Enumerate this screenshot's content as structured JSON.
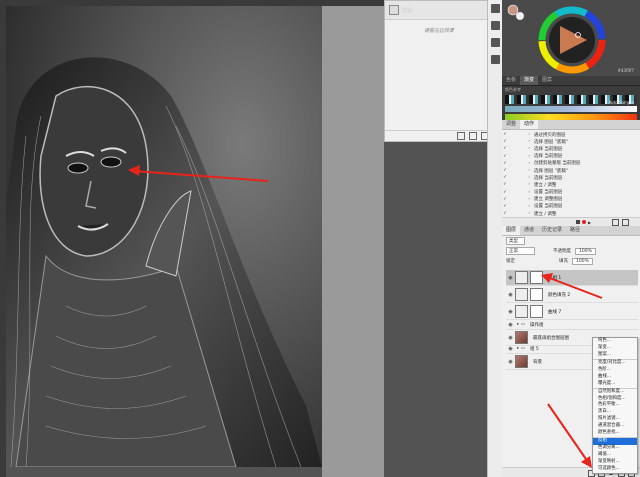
{
  "history_panel": {
    "title": "历史记录",
    "tab_label": "剪贴",
    "empty_message": "请看左边效果"
  },
  "color_panel": {
    "tabs": [
      "色板",
      "渐变",
      "图案",
      "颜色"
    ],
    "swatch_label": "颜色参考",
    "hex_value": "#43f0f7",
    "auto_label": "Auto Sample"
  },
  "actions_panel": {
    "tabs": [
      "调整",
      "动作"
    ],
    "rows": [
      {
        "label": "通过拷贝的图层",
        "sel": false
      },
      {
        "label": "选择 图层 \"底稿\"",
        "sel": false
      },
      {
        "label": "选择 当前图层",
        "sel": false
      },
      {
        "label": "选择 当前图层",
        "sel": false
      },
      {
        "label": "创建剪贴蒙版 当前图层",
        "sel": false
      },
      {
        "label": "选择 图层 \"底稿\"",
        "sel": false
      },
      {
        "label": "选择 当前图层",
        "sel": false
      },
      {
        "label": "建立 / 调整",
        "sel": false
      },
      {
        "label": "设置 当前图层",
        "sel": false
      },
      {
        "label": "建立 调整图层",
        "sel": false
      },
      {
        "label": "设置 当前图层",
        "sel": false
      },
      {
        "label": "建立 / 调整",
        "sel": false
      },
      {
        "label": "设置 当前调整图层",
        "sel": false
      },
      {
        "label": "建立 / 填充图层",
        "sel": false
      },
      {
        "label": "设置 当前图层",
        "sel": false
      },
      {
        "label": "建立 / 调整",
        "sel": true
      }
    ]
  },
  "layers_panel": {
    "tabs": [
      "图层",
      "通道",
      "历史记录",
      "路径"
    ],
    "search_kind": "类型",
    "blend_mode": "正常",
    "opacity_label": "不透明度",
    "opacity_value": "100%",
    "lock_label": "锁定",
    "fill_label": "填充",
    "fill_value": "100%",
    "layers": [
      {
        "name": "反相 1",
        "type": "adj",
        "sel": true,
        "thumb": "adj"
      },
      {
        "name": "颜色填充 2",
        "type": "adj",
        "sel": false,
        "thumb": "adj"
      },
      {
        "name": "曲线 7",
        "type": "adj",
        "sel": false,
        "thumb": "adj"
      },
      {
        "name": "操作组",
        "type": "group",
        "sel": false,
        "thumb": "none"
      },
      {
        "name": "最底再组合图层图",
        "type": "photo",
        "sel": false,
        "thumb": "photo"
      },
      {
        "name": "组 5",
        "type": "group",
        "sel": false,
        "thumb": "none"
      },
      {
        "name": "背景",
        "type": "photo",
        "sel": false,
        "thumb": "photo"
      }
    ]
  },
  "context_menu": {
    "items": [
      {
        "label": "纯色...",
        "hl": false,
        "sep": false
      },
      {
        "label": "渐变...",
        "hl": false,
        "sep": false
      },
      {
        "label": "图案...",
        "hl": false,
        "sep": true
      },
      {
        "label": "亮度/对比度...",
        "hl": false,
        "sep": false
      },
      {
        "label": "色阶...",
        "hl": false,
        "sep": false
      },
      {
        "label": "曲线...",
        "hl": false,
        "sep": false
      },
      {
        "label": "曝光度...",
        "hl": false,
        "sep": true
      },
      {
        "label": "自然饱和度...",
        "hl": false,
        "sep": false
      },
      {
        "label": "色相/饱和度...",
        "hl": false,
        "sep": false
      },
      {
        "label": "色彩平衡...",
        "hl": false,
        "sep": false
      },
      {
        "label": "黑白...",
        "hl": false,
        "sep": false
      },
      {
        "label": "照片滤镜...",
        "hl": false,
        "sep": false
      },
      {
        "label": "通道混合器...",
        "hl": false,
        "sep": false
      },
      {
        "label": "颜色查找...",
        "hl": false,
        "sep": true
      },
      {
        "label": "反相",
        "hl": true,
        "sep": false
      },
      {
        "label": "色调分离...",
        "hl": false,
        "sep": false
      },
      {
        "label": "阈值...",
        "hl": false,
        "sep": false
      },
      {
        "label": "渐变映射...",
        "hl": false,
        "sep": false
      },
      {
        "label": "可选颜色...",
        "hl": false,
        "sep": false
      }
    ]
  },
  "colors": {
    "arrow": "#e8231a",
    "highlight": "#1e6fd9"
  }
}
